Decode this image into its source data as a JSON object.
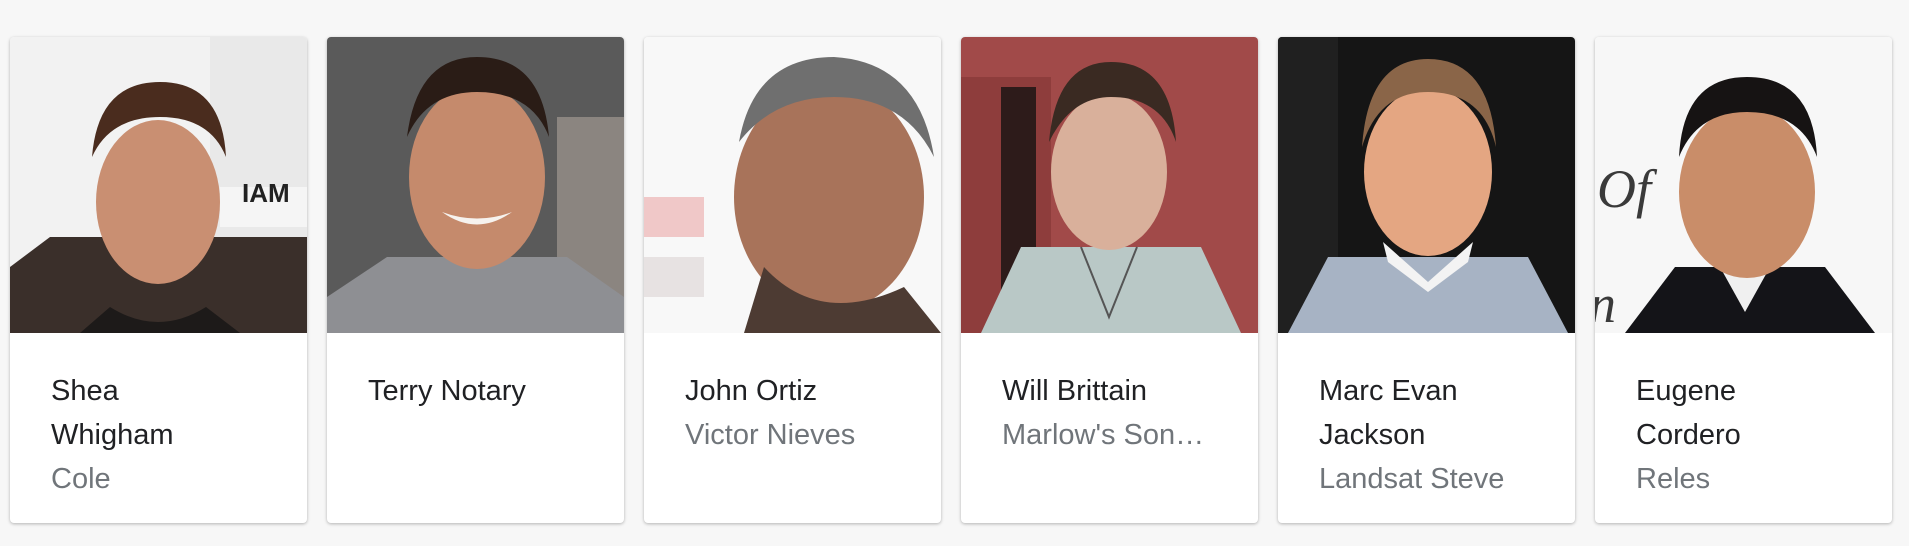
{
  "cast": [
    {
      "name_lines": [
        "Shea",
        "Whigham"
      ],
      "role": "Cole",
      "photo_alt": "Shea Whigham"
    },
    {
      "name_lines": [
        "Terry Notary",
        ""
      ],
      "role": "",
      "photo_alt": "Terry Notary"
    },
    {
      "name_lines": [
        "John Ortiz",
        ""
      ],
      "role": "Victor Nieves",
      "photo_alt": "John Ortiz"
    },
    {
      "name_lines": [
        "Will Brittain",
        ""
      ],
      "role": "Marlow's Son…",
      "photo_alt": "Will Brittain"
    },
    {
      "name_lines": [
        "Marc Evan",
        "Jackson"
      ],
      "role": "Landsat Steve",
      "photo_alt": "Marc Evan Jackson"
    },
    {
      "name_lines": [
        "Eugene",
        "Cordero"
      ],
      "role": "Reles",
      "photo_alt": "Eugene Cordero"
    }
  ],
  "colors": {
    "page_background": "#f7f7f7",
    "card_background": "#ffffff",
    "name_text": "#202124",
    "role_text": "#70757a"
  }
}
